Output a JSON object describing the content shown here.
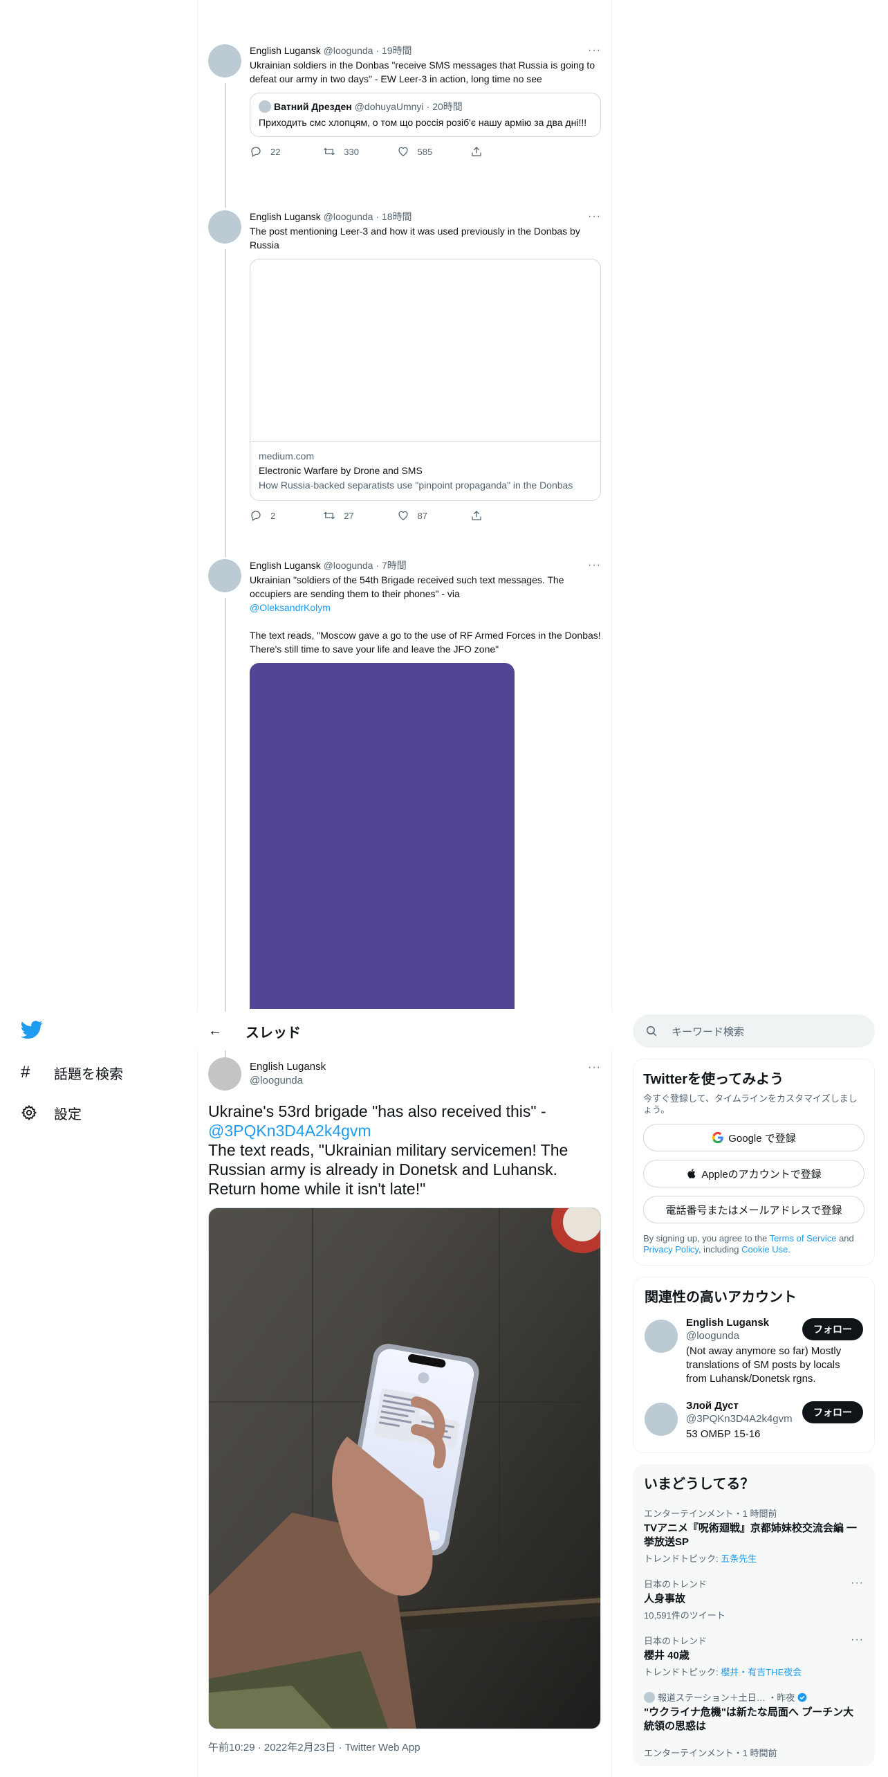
{
  "timeline": {
    "tweets": [
      {
        "name": "English Lugansk",
        "handle": "@loogunda",
        "time": "19時間",
        "text": "Ukrainian soldiers in the Donbas \"receive SMS messages that Russia is going to defeat our army in two days\" - EW Leer-3 in action, long time no see",
        "quote": {
          "name": "Ватний Дрезден",
          "handle": "@dohuyaUmnyi",
          "time": "20時間",
          "text": "Приходить смс хлопцям, о том що россія розіб'є нашу армію за два дні!!!"
        },
        "replies": "22",
        "retweets": "330",
        "likes": "585"
      },
      {
        "name": "English Lugansk",
        "handle": "@loogunda",
        "time": "18時間",
        "text": "The post mentioning Leer-3 and how it was used previously in the Donbas by Russia",
        "card": {
          "domain": "medium.com",
          "title": "Electronic Warfare by Drone and SMS",
          "description": "How Russia-backed separatists use \"pinpoint propaganda\" in the Donbas"
        },
        "replies": "2",
        "retweets": "27",
        "likes": "87"
      },
      {
        "name": "English Lugansk",
        "handle": "@loogunda",
        "time": "7時間",
        "text_line1": "Ukrainian \"soldiers of the 54th Brigade received such text messages. The occupiers are sending them to their phones\" - via",
        "mention": "@OleksandrKolym",
        "text_line2": "The text reads, \"Moscow gave a go to the use of RF Armed Forces in the Donbas! There's still time to save your life and leave the JFO zone\"",
        "media_color": "#524595"
      }
    ]
  },
  "header": {
    "back": "←",
    "title": "スレッド"
  },
  "focused_tweet": {
    "name": "English Lugansk",
    "handle": "@loogunda",
    "text_part1": "Ukraine's 53rd brigade \"has also received this\" -",
    "mention": "@3PQKn3D4A2k4gvm",
    "text_part2": "The text reads, \"Ukrainian military servicemen! The Russian army is already in Donetsk and Luhansk. Return home while it isn't late!\"",
    "meta": "午前10:29 · 2022年2月23日 · Twitter Web App"
  },
  "nav": {
    "items": [
      {
        "icon": "hashtag-icon",
        "label": "話題を検索"
      },
      {
        "icon": "gear-icon",
        "label": "設定"
      }
    ]
  },
  "search": {
    "placeholder": "キーワード検索"
  },
  "signup": {
    "title": "Twitterを使ってみよう",
    "subtitle": "今すぐ登録して、タイムラインをカスタマイズしましょう。",
    "google": "Google で登録",
    "apple": "Appleのアカウントで登録",
    "phone": "電話番号またはメールアドレスで登録",
    "terms_pre": "By signing up, you agree to the",
    "terms_link": "Terms of Service",
    "terms_and": "and",
    "privacy_link": "Privacy Policy",
    "terms_including": ", including",
    "cookie_link": "Cookie Use."
  },
  "recommendations": {
    "title": "関連性の高いアカウント",
    "follow_label": "フォロー",
    "accounts": [
      {
        "name": "English Lugansk",
        "handle": "@loogunda",
        "bio": "(Not away anymore so far) Mostly translations of SM posts by locals from Luhansk/Donetsk rgns."
      },
      {
        "name": "Злой Дуст",
        "handle": "@3PQKn3D4A2k4gvm",
        "bio": "53 ОМБР 15-16"
      }
    ]
  },
  "trends": {
    "title": "いまどうしてる？",
    "items": [
      {
        "context": "エンターテインメント・1 時間前",
        "name": "TVアニメ『呪術廻戦』京都姉妹校交流会編 一挙放送SP",
        "sub_label": "トレンドトピック: ",
        "sub_link": "五条先生"
      },
      {
        "context": "日本のトレンド",
        "name": "人身事故",
        "sub": "10,591件のツイート"
      },
      {
        "context": "日本のトレンド",
        "name": "櫻井 40歳",
        "sub_label": "トレンドトピック: ",
        "sub_link": "櫻井・有吉THE夜会"
      },
      {
        "context": "報道ステーション＋土日… ・昨夜",
        "name": "\"ウクライナ危機\"は新たな局面へ プーチン大統領の思惑は"
      },
      {
        "context": "エンターテインメント・1 時間前"
      }
    ]
  },
  "colors": {
    "accent": "#1d9bf0",
    "follow_button": "#0f1419",
    "purple_media": "#524595"
  }
}
